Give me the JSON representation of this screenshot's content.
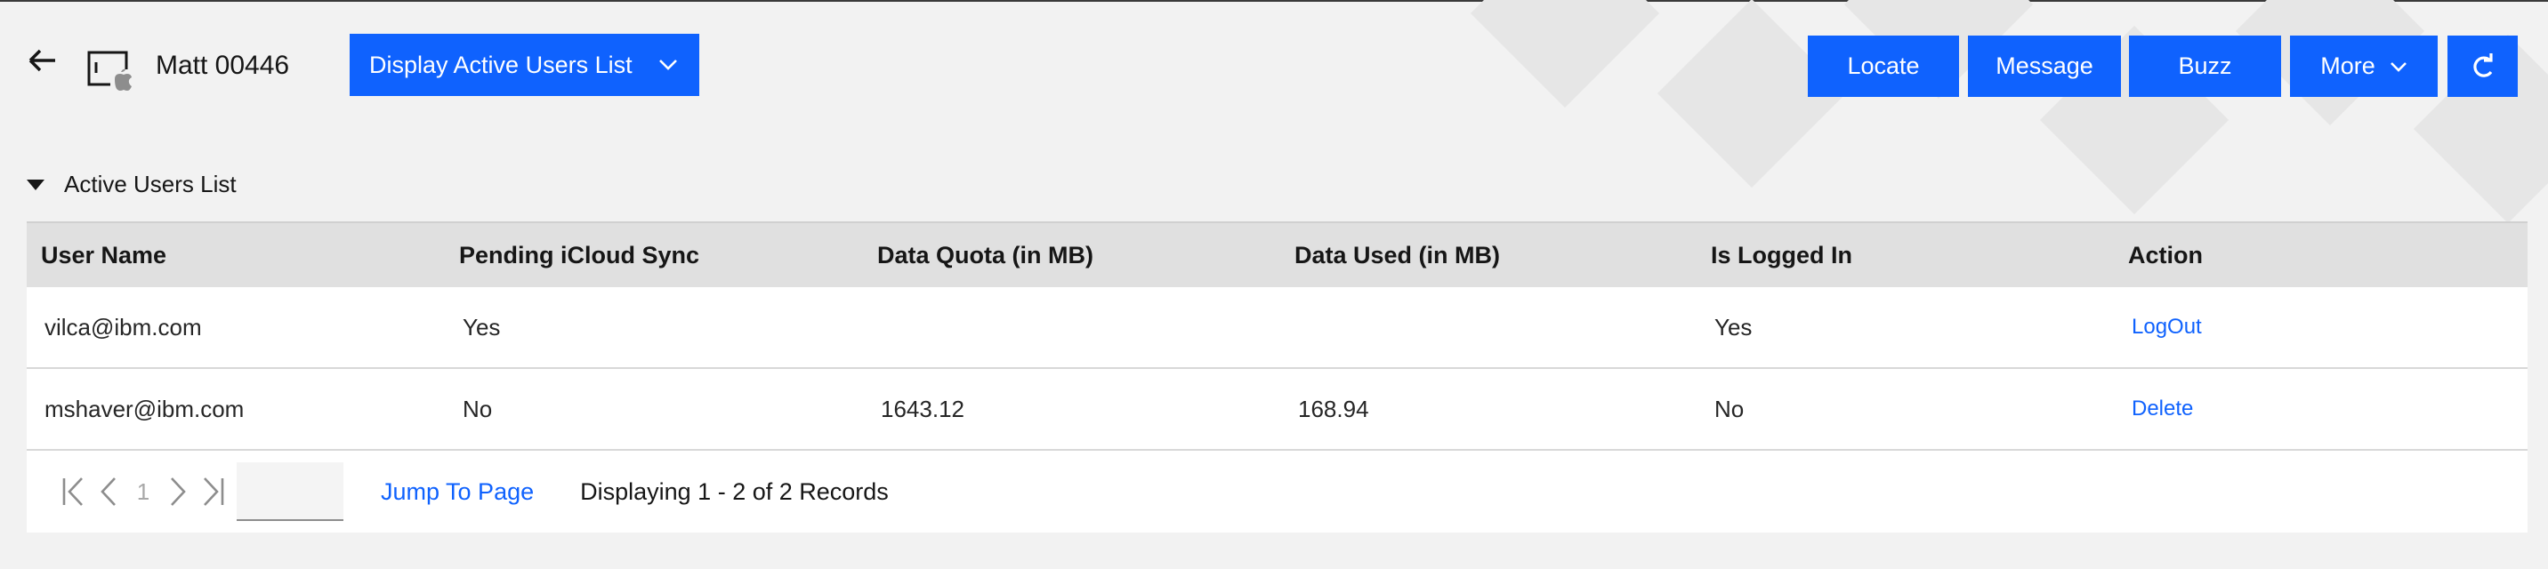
{
  "header": {
    "device_name": "Matt 00446",
    "view_dropdown_label": "Display Active Users List",
    "actions": {
      "locate": "Locate",
      "message": "Message",
      "buzz": "Buzz",
      "more": "More"
    }
  },
  "section": {
    "title": "Active Users List"
  },
  "table": {
    "columns": [
      "User Name",
      "Pending iCloud Sync",
      "Data Quota (in MB)",
      "Data Used (in MB)",
      "Is Logged In",
      "Action"
    ],
    "rows": [
      {
        "user": "vilca@ibm.com",
        "pending": "Yes",
        "quota": "",
        "used": "",
        "logged_in": "Yes",
        "action": "LogOut"
      },
      {
        "user": "mshaver@ibm.com",
        "pending": "No",
        "quota": "1643.12",
        "used": "168.94",
        "logged_in": "No",
        "action": "Delete"
      }
    ]
  },
  "pagination": {
    "current_page": "1",
    "jump_label": "Jump To Page",
    "records_text": "Displaying 1 - 2 of 2 Records"
  },
  "colors": {
    "primary": "#0f62fe",
    "header_bg": "#e0e0e0",
    "page_bg": "#f2f2f2"
  },
  "icons": [
    "back-arrow-icon",
    "apple-device-icon",
    "chevron-down-icon",
    "refresh-icon",
    "first-page-icon",
    "previous-page-icon",
    "next-page-icon",
    "last-page-icon",
    "caret-down-icon"
  ]
}
